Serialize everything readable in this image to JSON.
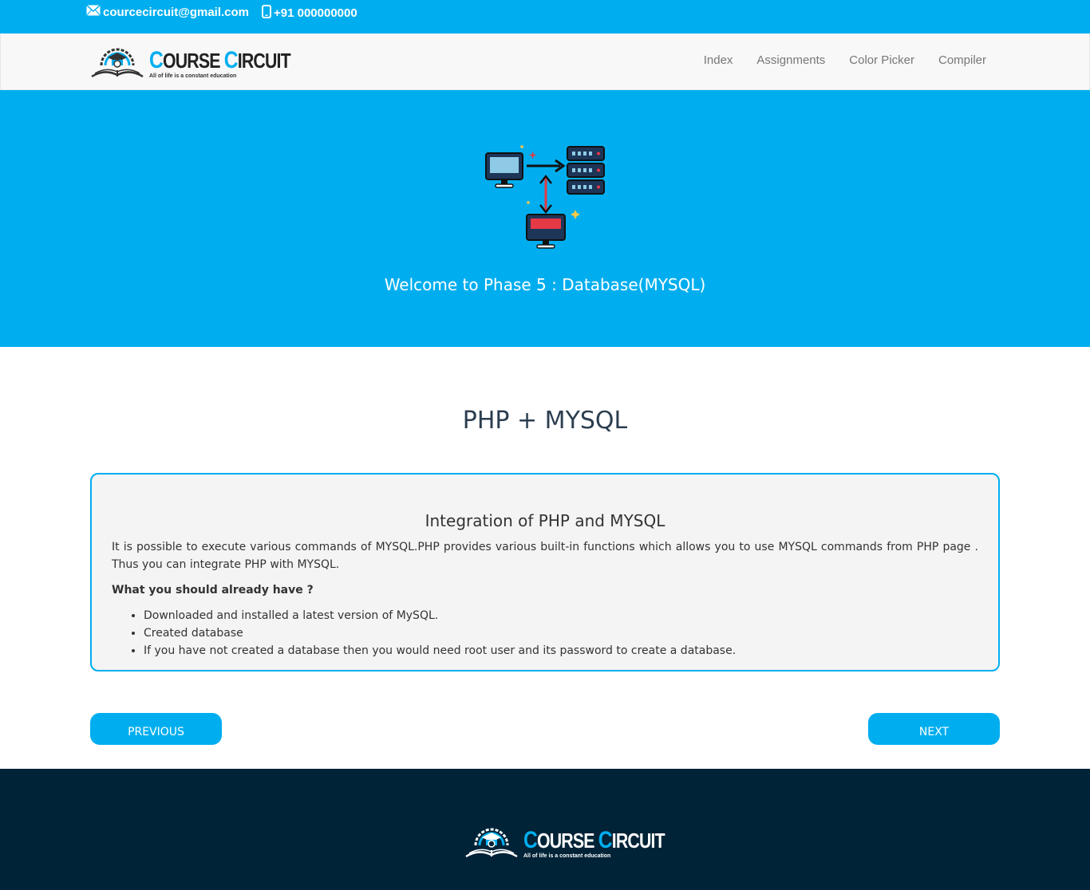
{
  "topbar": {
    "email": "courcecircuit@gmail.com",
    "phone": "+91 000000000"
  },
  "brand": {
    "name_first_cap": "C",
    "name_first_rest": "OURSE ",
    "name_second_cap": "C",
    "name_second_rest": "IRCUIT",
    "tagline": "All of life is a constant education"
  },
  "nav": {
    "items": [
      "Index",
      "Assignments",
      "Color Picker",
      "Compiler"
    ]
  },
  "hero": {
    "title": "Welcome to Phase 5 : Database(MYSQL)",
    "icon": "database-network-icon"
  },
  "main": {
    "title": "PHP + MYSQL",
    "card": {
      "title": "Integration of PHP and MYSQL",
      "intro": "It is possible to execute various commands of MYSQL.PHP provides various built-in functions which allows you to use MYSQL commands from PHP page . Thus you can integrate PHP with MYSQL.",
      "subhead": "What you should already have ?",
      "items": [
        "Downloaded and installed a latest version of MySQL.",
        "Created database",
        "If you have not created a database then you would need root user and its password to create a database."
      ]
    }
  },
  "buttons": {
    "previous": "PREVIOUS",
    "next": "NEXT"
  },
  "colors": {
    "accent": "#00aeef",
    "footer": "#002337"
  }
}
